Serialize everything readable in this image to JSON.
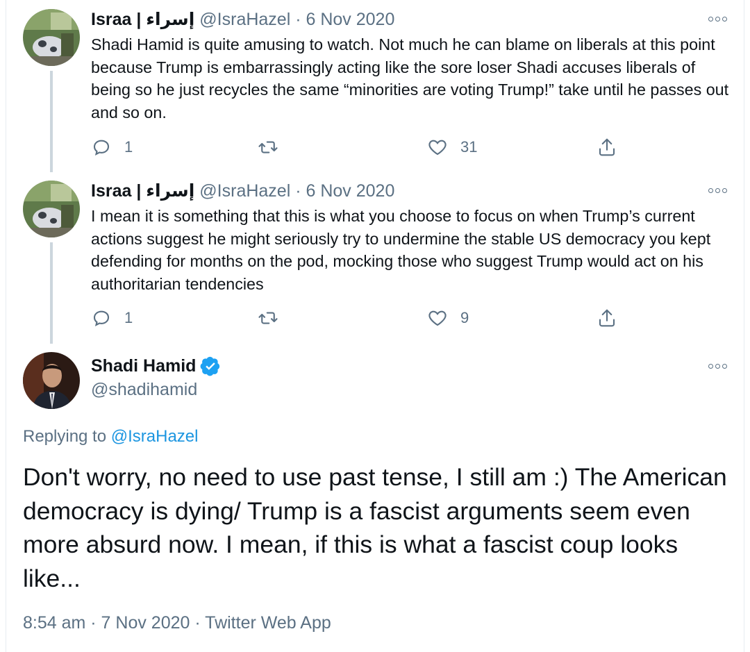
{
  "thread": [
    {
      "name": "Israa | إسراء",
      "handle": "@IsraHazel",
      "sep": " · ",
      "date": "6 Nov 2020",
      "text": "Shadi Hamid is quite amusing to watch. Not much he can blame on liberals at this point because Trump is embarrassingly acting like the sore loser Shadi accuses liberals of being so he just recycles the same “minorities are voting Trump!” take until he passes out and so on.",
      "replies": "1",
      "retweets": "",
      "likes": "31"
    },
    {
      "name": "Israa | إسراء",
      "handle": "@IsraHazel",
      "sep": " · ",
      "date": "6 Nov 2020",
      "text": "I mean it is something that this is what you choose to focus on when Trump’s current actions suggest he might seriously try to undermine the stable US democracy you kept defending for months on the pod, mocking those who suggest Trump would act on his authoritarian tendencies",
      "replies": "1",
      "retweets": "",
      "likes": "9"
    }
  ],
  "main": {
    "name": "Shadi Hamid",
    "handle": "@shadihamid",
    "replying_prefix": "Replying to ",
    "replying_to": "@IsraHazel",
    "text": "Don't worry, no need to use past tense, I still am :) The American democracy is dying/ Trump is a fascist arguments seem even more absurd now. I mean, if this is what a fascist coup looks like...",
    "timestamp": "8:54 am · 7 Nov 2020 · Twitter Web App"
  },
  "icons": {
    "reply": "reply-icon",
    "retweet": "retweet-icon",
    "like": "heart-icon",
    "share": "share-icon",
    "more": "more-options-icon",
    "verified": "verified-badge-icon"
  },
  "colors": {
    "text": "#0f1419",
    "secondary": "#5b7083",
    "link": "#1b95e0",
    "verified": "#1da1f2",
    "thread_line": "#ccd6dd"
  }
}
